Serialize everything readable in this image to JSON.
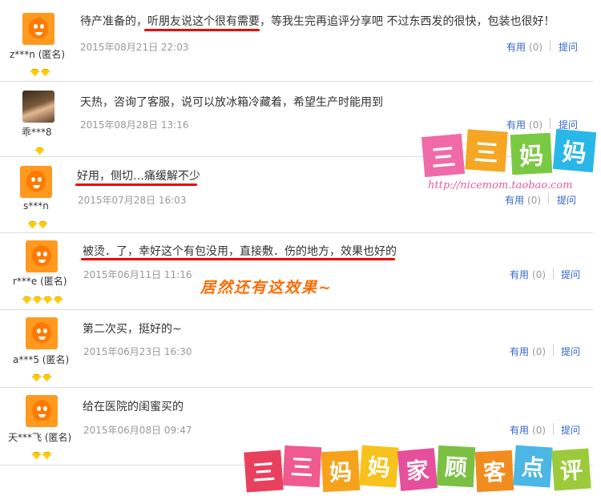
{
  "reviews": [
    {
      "user": "z***n (匿名)",
      "text": "待产准备的，听朋友说这个很有需要，等我生完再追评分享吧 不过东西发的很快，包装也很好！",
      "date": "2015年08月21日 22:03",
      "useful_label": "有用",
      "useful_count": "(0)",
      "ask_label": "提问",
      "gems": 2
    },
    {
      "user": "乖***8",
      "text": "天热，咨询了客服，说可以放冰箱冷藏着，希望生产时能用到",
      "date": "2015年08月28日 13:16",
      "useful_label": "有用",
      "useful_count": "(0)",
      "ask_label": "提问",
      "gems": 1
    },
    {
      "user": "s***n",
      "text": "好用，侧切…痛缓解不少",
      "date": "2015年07月28日 16:03",
      "useful_label": "有用",
      "useful_count": "(0)",
      "ask_label": "提问",
      "gems": 2
    },
    {
      "user": "r***e (匿名)",
      "text": "被烫．了，幸好这个有包没用，直接敷．伤的地方，效果也好的",
      "date": "2015年06月11日 11:16",
      "useful_label": "有用",
      "useful_count": "(0)",
      "ask_label": "提问",
      "gems": 4
    },
    {
      "user": "a***5 (匿名)",
      "text": "第二次买，挺好的~",
      "date": "2015年06月23日 16:30",
      "useful_label": "有用",
      "useful_count": "(0)",
      "ask_label": "提问",
      "gems": 2
    },
    {
      "user": "天***飞 (匿名)",
      "text": "给在医院的闺蜜买的",
      "date": "2015年06月08日 09:47",
      "useful_label": "有用",
      "useful_count": "(0)",
      "ask_label": "提问",
      "gems": 2
    }
  ],
  "annotation": "居然还有这效果~",
  "watermark": {
    "top_chars": [
      "三",
      "三",
      "妈",
      "妈"
    ],
    "url": "http://nicemom.taobao.com",
    "bottom_chars": [
      "三",
      "三",
      "妈",
      "妈",
      "家",
      "顾",
      "客",
      "点",
      "评"
    ]
  },
  "colors": {
    "link": "#3366cc",
    "underline": "#e00000",
    "annotation": "#ff6a00"
  }
}
